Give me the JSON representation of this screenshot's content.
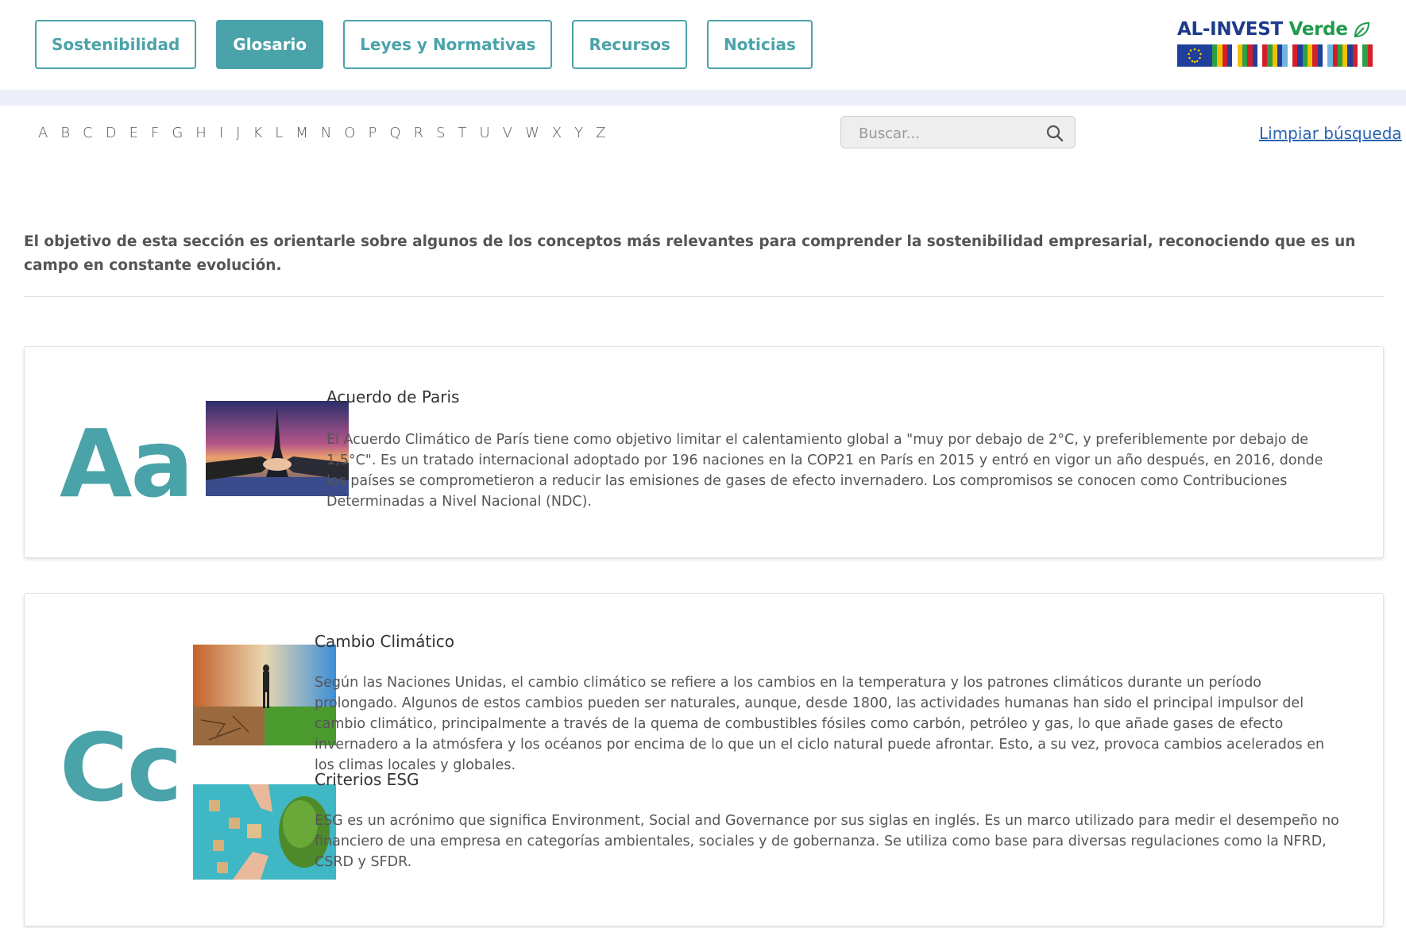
{
  "nav": {
    "items": [
      {
        "label": "Sostenibilidad",
        "active": false
      },
      {
        "label": "Glosario",
        "active": true
      },
      {
        "label": "Leyes y Normativas",
        "active": false
      },
      {
        "label": "Recursos",
        "active": false
      },
      {
        "label": "Noticias",
        "active": false
      }
    ]
  },
  "logo": {
    "part1": "AL-INVEST",
    "part2": "Verde",
    "icon": "leaf-icon"
  },
  "alphabet": [
    "A",
    "B",
    "C",
    "D",
    "E",
    "F",
    "G",
    "H",
    "I",
    "J",
    "K",
    "L",
    "M",
    "N",
    "O",
    "P",
    "Q",
    "R",
    "S",
    "T",
    "U",
    "V",
    "W",
    "X",
    "Y",
    "Z"
  ],
  "search": {
    "placeholder": "Buscar...",
    "icon": "search-icon"
  },
  "clear_search": "Limpiar búsqueda",
  "intro": "El objetivo de esta sección es orientarle sobre algunos de los conceptos más relevantes para comprender la sostenibilidad empresarial, reconociendo que es un campo en constante evolución.",
  "sections": [
    {
      "letter": "Aa",
      "terms": [
        {
          "title": "Acuerdo de Paris",
          "description": "El Acuerdo Climático de París tiene como objetivo limitar el calentamiento global a \"muy por debajo de 2°C, y preferiblemente por debajo de 1,5°C\". Es un tratado internacional adoptado por 196 naciones en la COP21 en París en 2015 y entró en vigor un año después, en 2016, donde los países se comprometieron a reducir las emisiones de gases de efecto invernadero. Los compromisos se conocen como Contribuciones Determinadas a Nivel Nacional (NDC)."
        }
      ]
    },
    {
      "letter": "Cc",
      "terms": [
        {
          "title": "Cambio Climático",
          "description": "Según las Naciones Unidas, el cambio climático se refiere a los cambios en la temperatura y los patrones climáticos durante un período prolongado. Algunos de estos cambios pueden ser naturales, aunque, desde 1800, las actividades humanas han sido el principal impulsor del cambio climático, principalmente a través de la quema de combustibles fósiles como carbón, petróleo y gas, lo que añade gases de efecto invernadero a la atmósfera y los océanos por encima de lo que un el ciclo natural puede afrontar. Esto, a su vez, provoca cambios acelerados en los climas locales y globales."
        },
        {
          "title": "Criterios ESG",
          "description": "ESG es un acrónimo que significa Environment, Social and Governance por sus siglas en inglés. Es un marco utilizado para medir el desempeño no financiero de una empresa en categorías ambientales, sociales y de gobernanza. Se utiliza como base para diversas regulaciones como la NFRD, CSRD y SFDR."
        }
      ]
    }
  ],
  "colors": {
    "accent": "#4aa3a8",
    "link": "#2a63b0",
    "logo_blue": "#1e3a8a",
    "logo_green": "#1f9a4a"
  }
}
